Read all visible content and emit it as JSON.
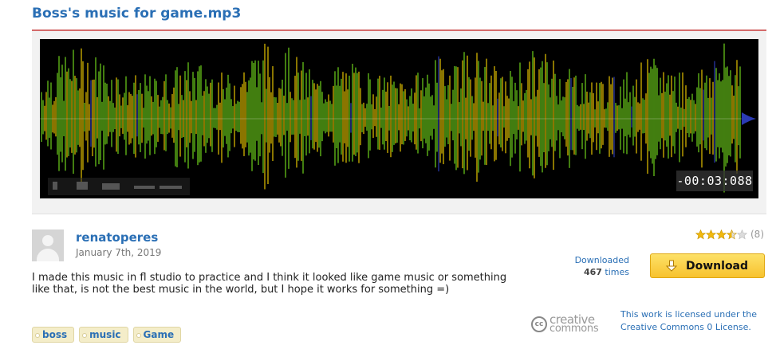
{
  "page": {
    "title": "Boss's music for game.mp3"
  },
  "player": {
    "time_remaining": "-00:03:088",
    "colors": {
      "background": "#000000",
      "wave_green": "#6fd11c",
      "wave_yellow": "#e6c300",
      "wave_accent": "#2b3bb5"
    }
  },
  "author": {
    "name": "renatoperes",
    "date": "January 7th, 2019"
  },
  "description": "I made this music in fl studio to practice and I think it looked like game music or something like that, is not the best music in the world, but I hope it works for something =)",
  "tags": [
    "boss",
    "music",
    "Game"
  ],
  "rating": {
    "stars": 3.5,
    "max": 5,
    "count": "(8)"
  },
  "downloads": {
    "label": "Downloaded",
    "count": "467",
    "suffix": "times"
  },
  "download_button": {
    "label": "Download",
    "icon": "download-arrow-icon"
  },
  "license": {
    "logo_line1": "creative",
    "logo_line2": "commons",
    "logo_badge": "cc",
    "text": "This work is licensed under the Creative Commons 0 License."
  }
}
